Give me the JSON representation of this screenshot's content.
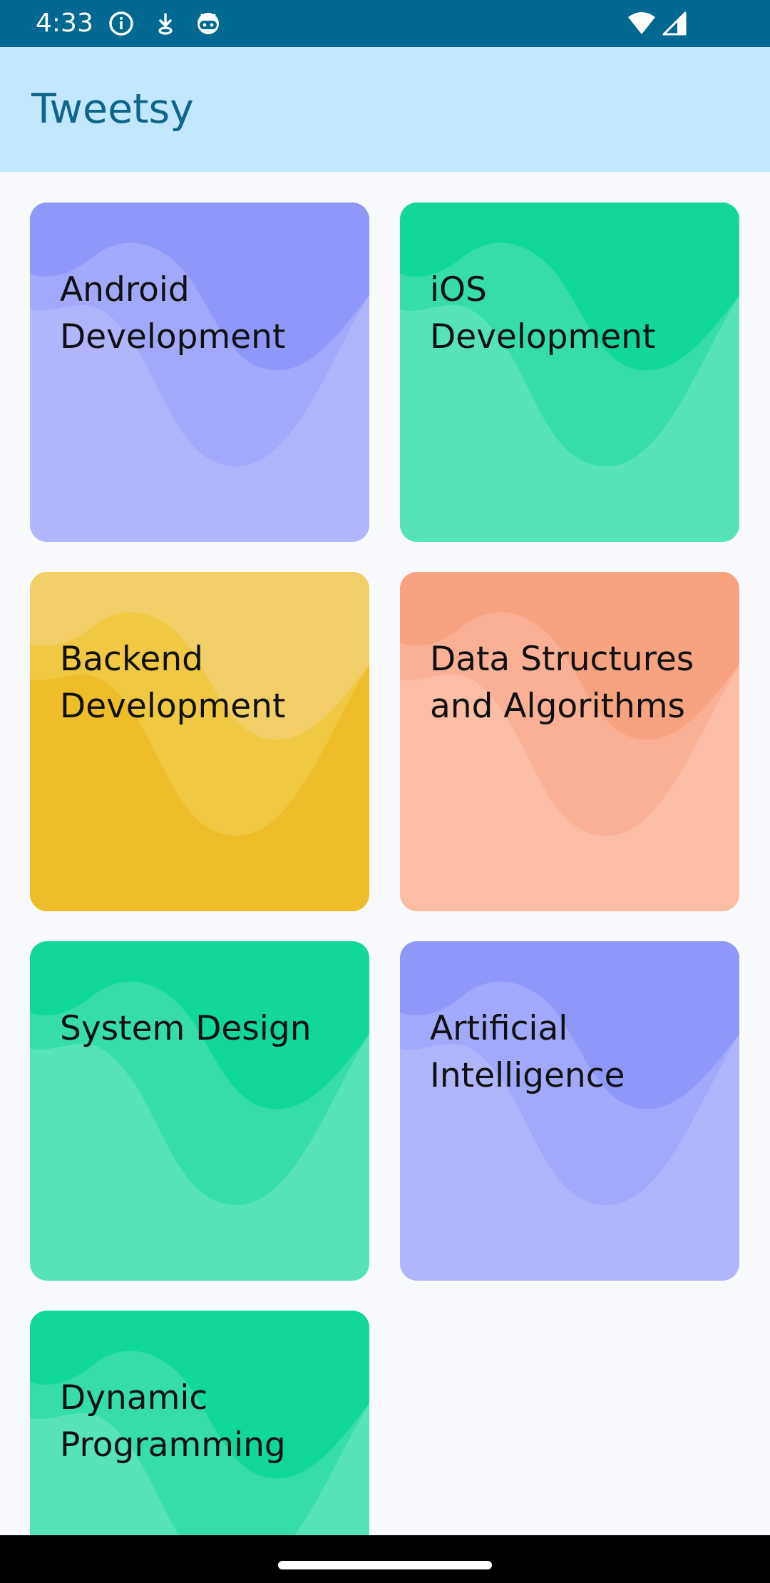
{
  "status_bar": {
    "time": "4:33",
    "icons": [
      "info-icon",
      "download-icon",
      "android-face-icon",
      "wifi-icon",
      "signal-icon"
    ]
  },
  "app_bar": {
    "title": "Tweetsy"
  },
  "categories": [
    {
      "title": "Android\nDevelopment",
      "colors": [
        "#8f98f9",
        "#a2a9fb",
        "#b0b5fc"
      ]
    },
    {
      "title": "iOS\nDevelopment",
      "colors": [
        "#12d79a",
        "#36ddaa",
        "#57e3b9"
      ]
    },
    {
      "title": "Backend\nDevelopment",
      "colors": [
        "#f2cf66",
        "#f0c842",
        "#efbc2a"
      ]
    },
    {
      "title": "Data Structures\nand Algorithms",
      "colors": [
        "#f8a37f",
        "#fab095",
        "#fbbda4"
      ]
    },
    {
      "title": "System Design",
      "colors": [
        "#12d79a",
        "#36ddaa",
        "#57e3b9"
      ]
    },
    {
      "title": "Artificial\nIntelligence",
      "colors": [
        "#8f98f9",
        "#a2a9fb",
        "#b0b5fc"
      ]
    },
    {
      "title": "Dynamic\nProgramming",
      "colors": [
        "#12d79a",
        "#36ddaa",
        "#57e3b9"
      ]
    }
  ]
}
